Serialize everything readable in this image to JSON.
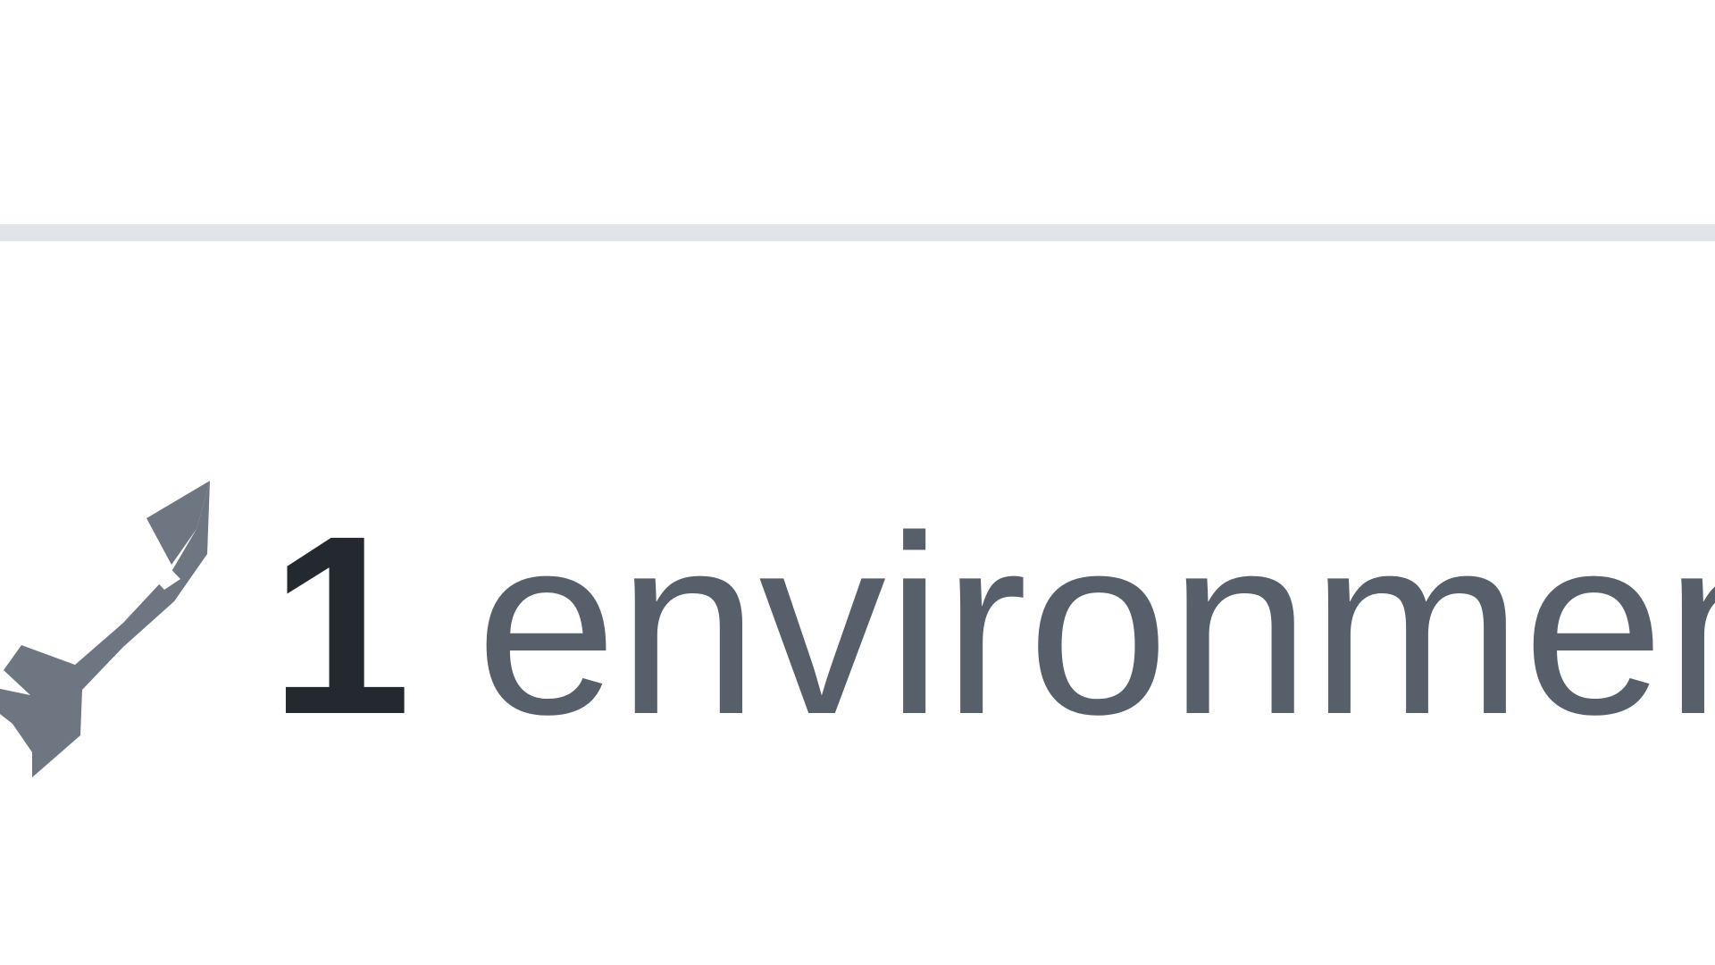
{
  "environments": {
    "count": "1",
    "label": "environments",
    "icon": "rocket-icon",
    "icon_color": "#6e7781",
    "count_color": "#24292f",
    "label_color": "#57606a"
  },
  "divider_color": "#e1e4e8"
}
